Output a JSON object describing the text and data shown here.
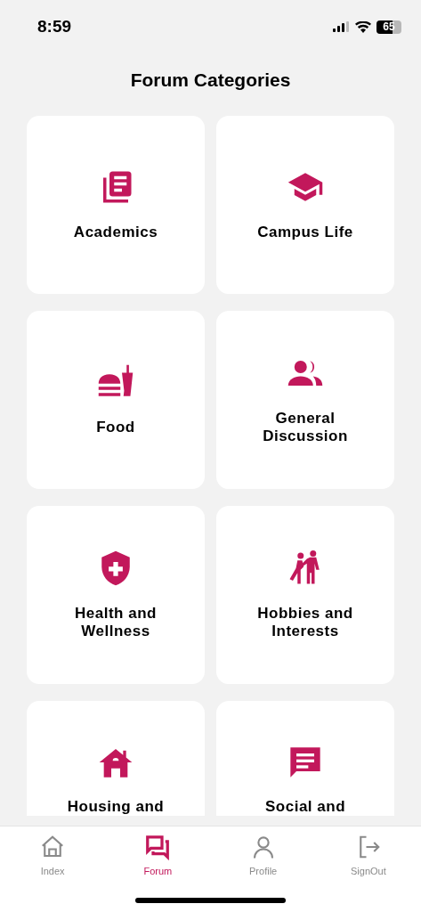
{
  "status_bar": {
    "time": "8:59",
    "battery": "65"
  },
  "title": "Forum Categories",
  "categories": [
    {
      "label": "Academics"
    },
    {
      "label": "Campus Life"
    },
    {
      "label": "Food"
    },
    {
      "label": "General Discussion"
    },
    {
      "label": "Health and Wellness"
    },
    {
      "label": "Hobbies and Interests"
    },
    {
      "label": "Housing and"
    },
    {
      "label": "Social and"
    }
  ],
  "tabs": [
    {
      "label": "Index",
      "selected": false
    },
    {
      "label": "Forum",
      "selected": true
    },
    {
      "label": "Profile",
      "selected": false
    },
    {
      "label": "SignOut",
      "selected": false
    }
  ]
}
